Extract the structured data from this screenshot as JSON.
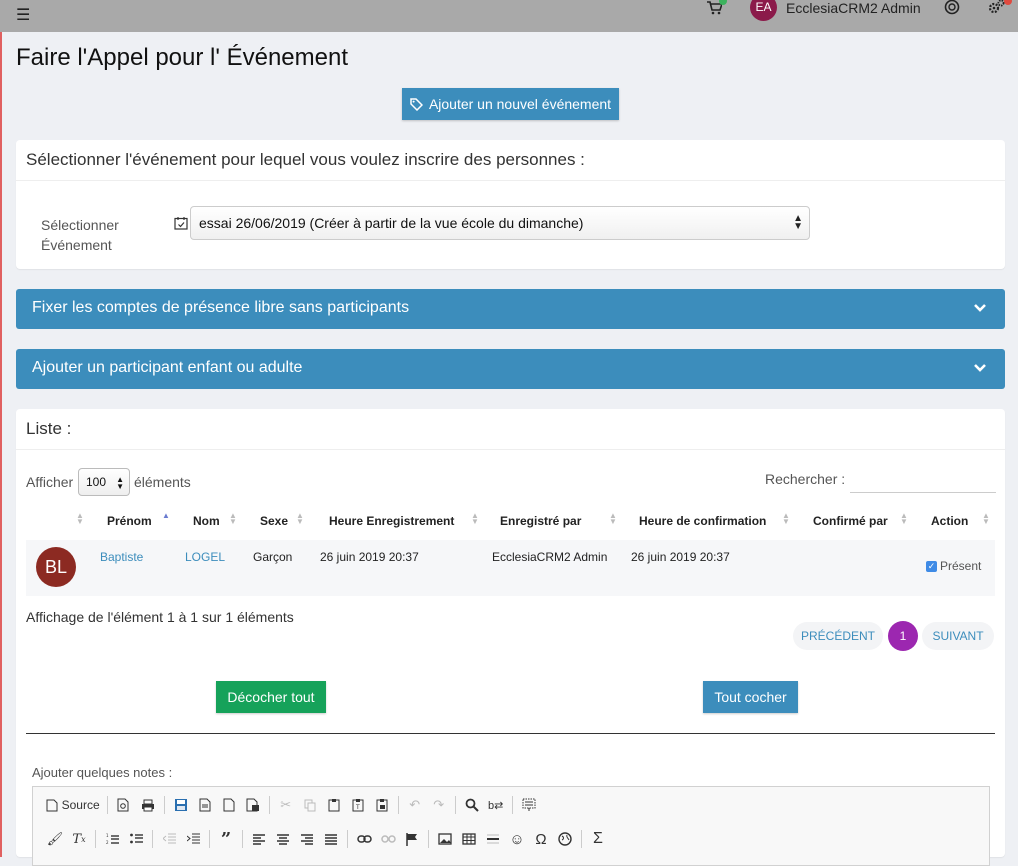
{
  "topbar": {
    "avatar_initials": "EA",
    "user_name": "EcclesiaCRM2 Admin"
  },
  "page": {
    "title": "Faire l'Appel pour l' Événement",
    "add_event_button": "Ajouter un nouvel événement"
  },
  "select_card": {
    "heading": "Sélectionner l'événement pour lequel vous voulez inscrire des personnes :",
    "label_line1": "Sélectionner",
    "label_line2": "Événement",
    "selected_event": "essai 26/06/2019 (Créer à partir de la vue école du dimanche)"
  },
  "accordions": [
    {
      "label": "Fixer les comptes de présence libre sans participants"
    },
    {
      "label": "Ajouter un participant enfant ou adulte"
    }
  ],
  "list": {
    "title": "Liste :",
    "show_label": "Afficher",
    "page_length": "100",
    "elements_label": "éléments",
    "search_label": "Rechercher :",
    "columns": [
      "Prénom",
      "Nom",
      "Sexe",
      "Heure Enregistrement",
      "Enregistré par",
      "Heure de confirmation",
      "Confirmé par",
      "Action"
    ],
    "rows": [
      {
        "initials": "BL",
        "first_name": "Baptiste",
        "last_name": "LOGEL",
        "gender": "Garçon",
        "checkin_time": "26 juin 2019 20:37",
        "checked_in_by": "EcclesiaCRM2 Admin",
        "confirm_time": "26 juin 2019 20:37",
        "confirmed_by": "",
        "action_label": "Présent"
      }
    ],
    "info": "Affichage de l'élément 1 à 1 sur 1 éléments",
    "prev": "PRÉCÉDENT",
    "page": "1",
    "next": "SUIVANT",
    "uncheck_all": "Décocher tout",
    "check_all": "Tout cocher",
    "notes_label": "Ajouter quelques notes :",
    "source_label": "Source"
  },
  "colors": {
    "primary": "#3c8dbc",
    "success": "#16a25a",
    "pagination_active": "#9c27b0"
  }
}
